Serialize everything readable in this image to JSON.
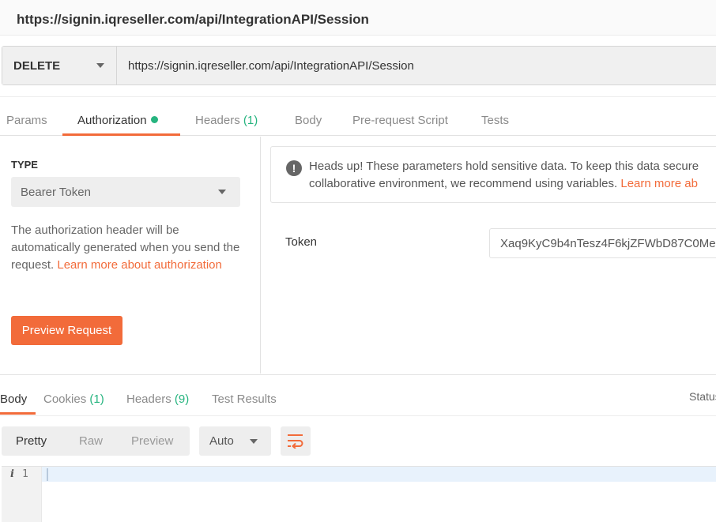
{
  "window": {
    "title": "https://signin.iqreseller.com/api/IntegrationAPI/Session"
  },
  "request": {
    "method": "DELETE",
    "url": "https://signin.iqreseller.com/api/IntegrationAPI/Session"
  },
  "request_tabs": [
    {
      "label": "Params"
    },
    {
      "label": "Authorization",
      "indicator": "green-dot"
    },
    {
      "label": "Headers",
      "count": "(1)"
    },
    {
      "label": "Body"
    },
    {
      "label": "Pre-request Script"
    },
    {
      "label": "Tests"
    }
  ],
  "auth": {
    "type_heading": "TYPE",
    "type_value": "Bearer Token",
    "description": "The authorization header will be automatically generated when you send the request. ",
    "learn_more": "Learn more about authorization",
    "preview_button": "Preview Request",
    "notice_line1": "Heads up! These parameters hold sensitive data. To keep this data secure",
    "notice_line2_text": "collaborative environment, we recommend using variables. ",
    "notice_link": "Learn more ab",
    "token_label": "Token",
    "token_value": "Xaq9KyC9b4nTesz4F6kjZFWbD87C0Me"
  },
  "response_tabs": [
    {
      "label": "Body"
    },
    {
      "label": "Cookies",
      "count": "(1)"
    },
    {
      "label": "Headers",
      "count": "(9)"
    },
    {
      "label": "Test Results"
    }
  ],
  "response": {
    "status_label": "Status",
    "view_options": [
      "Pretty",
      "Raw",
      "Preview"
    ],
    "format": "Auto",
    "line_number": "1"
  },
  "colors": {
    "accent": "#f26b3a",
    "count_green": "#26b47f"
  }
}
